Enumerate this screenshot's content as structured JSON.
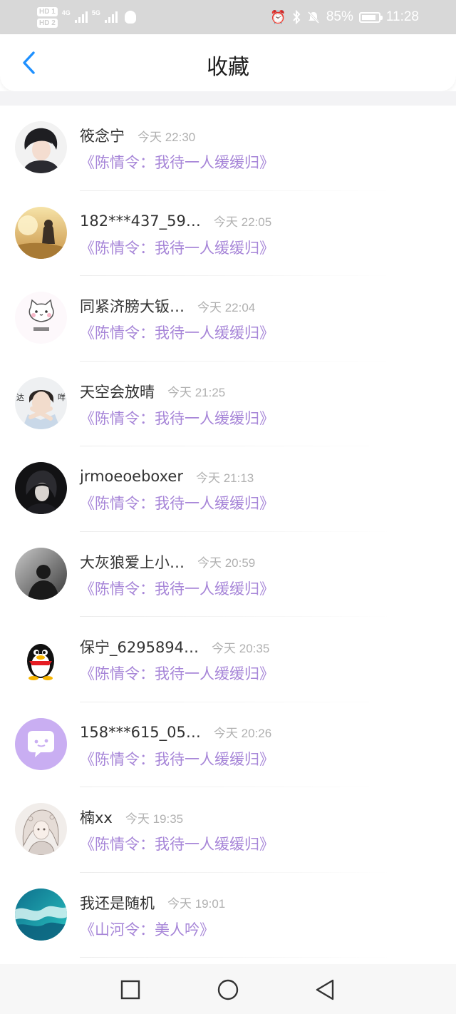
{
  "status_bar": {
    "hd1": "HD 1",
    "hd2": "HD 2",
    "net1": "4G",
    "net2": "5G",
    "battery_percent": "85%",
    "battery_level": 0.85,
    "time": "11:28",
    "icons": [
      "alarm-icon",
      "bluetooth-icon",
      "mute-icon",
      "battery-icon",
      "qq-icon"
    ]
  },
  "header": {
    "title": "收藏",
    "back_icon": "chevron-left-icon",
    "accent_color": "#1e90ff"
  },
  "colors": {
    "work_title": "#a786d8",
    "name": "#333333",
    "time": "#b0b0b0"
  },
  "favorites": [
    {
      "name": "筱念宁",
      "time": "今天 22:30",
      "work": "《陈情令：我待一人缓缓归》",
      "avatar": "dark-haired-boy-avatar"
    },
    {
      "name": "182***437_59…",
      "time": "今天 22:05",
      "work": "《陈情令：我待一人缓缓归》",
      "avatar": "sunset-field-avatar"
    },
    {
      "name": "同紧济膀大钣…",
      "time": "今天 22:04",
      "work": "《陈情令：我待一人缓缓归》",
      "avatar": "cartoon-cat-avatar"
    },
    {
      "name": "天空会放晴",
      "time": "今天 21:25",
      "work": "《陈情令：我待一人缓缓归》",
      "avatar": "young-man-photo-avatar"
    },
    {
      "name": "jrmoeoeboxer",
      "time": "今天 21:13",
      "work": "《陈情令：我待一人缓缓归》",
      "avatar": "dark-anime-avatar"
    },
    {
      "name": "大灰狼爱上小…",
      "time": "今天 20:59",
      "work": "《陈情令：我待一人缓缓归》",
      "avatar": "silhouette-avatar"
    },
    {
      "name": "保宁_6295894…",
      "time": "今天 20:35",
      "work": "《陈情令：我待一人缓缓归》",
      "avatar": "qq-penguin-avatar"
    },
    {
      "name": "158***615_05…",
      "time": "今天 20:26",
      "work": "《陈情令：我待一人缓缓归》",
      "avatar": "purple-chat-bubble-avatar"
    },
    {
      "name": "楠xx",
      "time": "今天 19:35",
      "work": "《陈情令：我待一人缓缓归》",
      "avatar": "anime-girl-sketch-avatar"
    },
    {
      "name": "我还是随机",
      "time": "今天 19:01",
      "work": "《山河令：美人吟》",
      "avatar": "ocean-wave-avatar"
    }
  ],
  "nav_bar": {
    "icons": [
      "recent-apps-icon",
      "home-icon",
      "back-icon"
    ]
  }
}
